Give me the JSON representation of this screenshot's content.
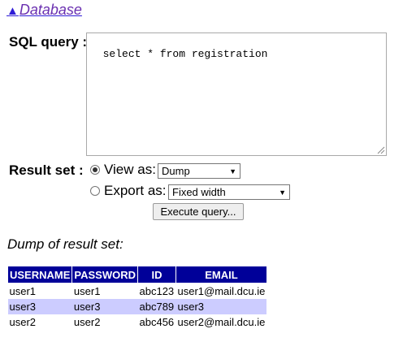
{
  "nav": {
    "triangle": "▲",
    "label": "Database"
  },
  "sql": {
    "label": "SQL query :",
    "query": "select * from registration"
  },
  "result_set": {
    "label": "Result set :",
    "view_as_label": "View as:",
    "view_as_value": "Dump",
    "export_as_label": "Export as:",
    "export_as_value": "Fixed width",
    "execute_label": "Execute query..."
  },
  "dump": {
    "heading": "Dump of result set:",
    "columns": [
      "USERNAME",
      "PASSWORD",
      "ID",
      "EMAIL"
    ],
    "rows": [
      [
        "user1",
        "user1",
        "abc123",
        "user1@mail.dcu.ie"
      ],
      [
        "user3",
        "user3",
        "abc789",
        "user3"
      ],
      [
        "user2",
        "user2",
        "abc456",
        "user2@mail.dcu.ie"
      ]
    ]
  },
  "colors": {
    "header_bg": "#000099",
    "alt_row_bg": "#ccccff",
    "link": "#2f1dd6"
  }
}
